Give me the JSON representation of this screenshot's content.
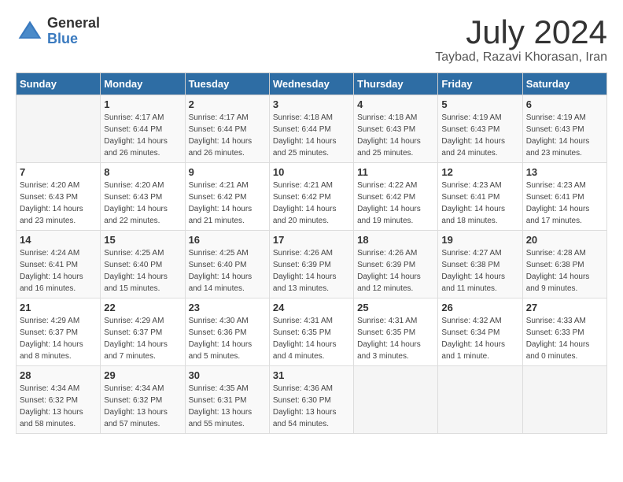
{
  "logo": {
    "general": "General",
    "blue": "Blue"
  },
  "title": {
    "month": "July 2024",
    "location": "Taybad, Razavi Khorasan, Iran"
  },
  "headers": [
    "Sunday",
    "Monday",
    "Tuesday",
    "Wednesday",
    "Thursday",
    "Friday",
    "Saturday"
  ],
  "weeks": [
    [
      {
        "day": "",
        "info": ""
      },
      {
        "day": "1",
        "info": "Sunrise: 4:17 AM\nSunset: 6:44 PM\nDaylight: 14 hours\nand 26 minutes."
      },
      {
        "day": "2",
        "info": "Sunrise: 4:17 AM\nSunset: 6:44 PM\nDaylight: 14 hours\nand 26 minutes."
      },
      {
        "day": "3",
        "info": "Sunrise: 4:18 AM\nSunset: 6:44 PM\nDaylight: 14 hours\nand 25 minutes."
      },
      {
        "day": "4",
        "info": "Sunrise: 4:18 AM\nSunset: 6:43 PM\nDaylight: 14 hours\nand 25 minutes."
      },
      {
        "day": "5",
        "info": "Sunrise: 4:19 AM\nSunset: 6:43 PM\nDaylight: 14 hours\nand 24 minutes."
      },
      {
        "day": "6",
        "info": "Sunrise: 4:19 AM\nSunset: 6:43 PM\nDaylight: 14 hours\nand 23 minutes."
      }
    ],
    [
      {
        "day": "7",
        "info": "Sunrise: 4:20 AM\nSunset: 6:43 PM\nDaylight: 14 hours\nand 23 minutes."
      },
      {
        "day": "8",
        "info": "Sunrise: 4:20 AM\nSunset: 6:43 PM\nDaylight: 14 hours\nand 22 minutes."
      },
      {
        "day": "9",
        "info": "Sunrise: 4:21 AM\nSunset: 6:42 PM\nDaylight: 14 hours\nand 21 minutes."
      },
      {
        "day": "10",
        "info": "Sunrise: 4:21 AM\nSunset: 6:42 PM\nDaylight: 14 hours\nand 20 minutes."
      },
      {
        "day": "11",
        "info": "Sunrise: 4:22 AM\nSunset: 6:42 PM\nDaylight: 14 hours\nand 19 minutes."
      },
      {
        "day": "12",
        "info": "Sunrise: 4:23 AM\nSunset: 6:41 PM\nDaylight: 14 hours\nand 18 minutes."
      },
      {
        "day": "13",
        "info": "Sunrise: 4:23 AM\nSunset: 6:41 PM\nDaylight: 14 hours\nand 17 minutes."
      }
    ],
    [
      {
        "day": "14",
        "info": "Sunrise: 4:24 AM\nSunset: 6:41 PM\nDaylight: 14 hours\nand 16 minutes."
      },
      {
        "day": "15",
        "info": "Sunrise: 4:25 AM\nSunset: 6:40 PM\nDaylight: 14 hours\nand 15 minutes."
      },
      {
        "day": "16",
        "info": "Sunrise: 4:25 AM\nSunset: 6:40 PM\nDaylight: 14 hours\nand 14 minutes."
      },
      {
        "day": "17",
        "info": "Sunrise: 4:26 AM\nSunset: 6:39 PM\nDaylight: 14 hours\nand 13 minutes."
      },
      {
        "day": "18",
        "info": "Sunrise: 4:26 AM\nSunset: 6:39 PM\nDaylight: 14 hours\nand 12 minutes."
      },
      {
        "day": "19",
        "info": "Sunrise: 4:27 AM\nSunset: 6:38 PM\nDaylight: 14 hours\nand 11 minutes."
      },
      {
        "day": "20",
        "info": "Sunrise: 4:28 AM\nSunset: 6:38 PM\nDaylight: 14 hours\nand 9 minutes."
      }
    ],
    [
      {
        "day": "21",
        "info": "Sunrise: 4:29 AM\nSunset: 6:37 PM\nDaylight: 14 hours\nand 8 minutes."
      },
      {
        "day": "22",
        "info": "Sunrise: 4:29 AM\nSunset: 6:37 PM\nDaylight: 14 hours\nand 7 minutes."
      },
      {
        "day": "23",
        "info": "Sunrise: 4:30 AM\nSunset: 6:36 PM\nDaylight: 14 hours\nand 5 minutes."
      },
      {
        "day": "24",
        "info": "Sunrise: 4:31 AM\nSunset: 6:35 PM\nDaylight: 14 hours\nand 4 minutes."
      },
      {
        "day": "25",
        "info": "Sunrise: 4:31 AM\nSunset: 6:35 PM\nDaylight: 14 hours\nand 3 minutes."
      },
      {
        "day": "26",
        "info": "Sunrise: 4:32 AM\nSunset: 6:34 PM\nDaylight: 14 hours\nand 1 minute."
      },
      {
        "day": "27",
        "info": "Sunrise: 4:33 AM\nSunset: 6:33 PM\nDaylight: 14 hours\nand 0 minutes."
      }
    ],
    [
      {
        "day": "28",
        "info": "Sunrise: 4:34 AM\nSunset: 6:32 PM\nDaylight: 13 hours\nand 58 minutes."
      },
      {
        "day": "29",
        "info": "Sunrise: 4:34 AM\nSunset: 6:32 PM\nDaylight: 13 hours\nand 57 minutes."
      },
      {
        "day": "30",
        "info": "Sunrise: 4:35 AM\nSunset: 6:31 PM\nDaylight: 13 hours\nand 55 minutes."
      },
      {
        "day": "31",
        "info": "Sunrise: 4:36 AM\nSunset: 6:30 PM\nDaylight: 13 hours\nand 54 minutes."
      },
      {
        "day": "",
        "info": ""
      },
      {
        "day": "",
        "info": ""
      },
      {
        "day": "",
        "info": ""
      }
    ]
  ]
}
